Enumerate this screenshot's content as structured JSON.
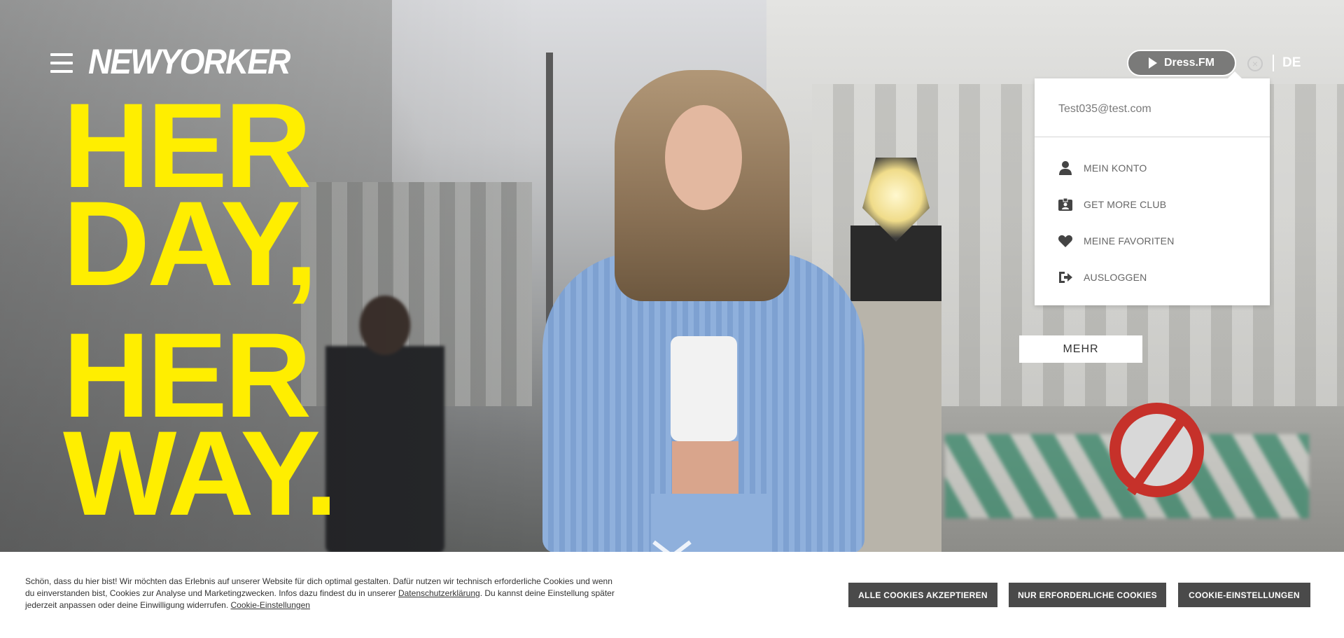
{
  "brand": {
    "logo_text": "NEWYORKER"
  },
  "header": {
    "menu_icon": "hamburger-icon",
    "dressfm_label": "Dress.FM",
    "close_icon": "close-circle-icon",
    "language": "DE"
  },
  "hero": {
    "headline": [
      "HER",
      "DAY,",
      "HER",
      "WAY."
    ],
    "more_button": "MEHR",
    "scroll_icon": "chevron-down-icon"
  },
  "account_menu": {
    "email": "Test035@test.com",
    "items": [
      {
        "label": "MEIN KONTO",
        "icon": "user-icon"
      },
      {
        "label": "GET MORE CLUB",
        "icon": "member-card-icon"
      },
      {
        "label": "MEINE FAVORITEN",
        "icon": "heart-icon"
      },
      {
        "label": "AUSLOGGEN",
        "icon": "logout-icon"
      }
    ]
  },
  "cookie_banner": {
    "text_part1": "Schön, dass du hier bist! Wir möchten das Erlebnis auf unserer Website für dich optimal gestalten. Dafür nutzen wir technisch erforderliche Cookies und wenn du einverstanden bist, Cookies zur Analyse und Marketingzwecken. Infos dazu findest du in unserer ",
    "privacy_link": "Datenschutzerklärung",
    "text_part2": ". Du kannst deine Einstellung später jederzeit anpassen oder deine Einwilligung widerrufen. ",
    "settings_link": "Cookie-Einstellungen",
    "accept_all": "ALLE COOKIES AKZEPTIEREN",
    "only_required": "NUR ERFORDERLICHE COOKIES",
    "settings": "COOKIE-EINSTELLUNGEN"
  },
  "colors": {
    "headline": "#ffee00",
    "button_dark": "#4a4a4a",
    "panel_bg": "#ffffff"
  }
}
